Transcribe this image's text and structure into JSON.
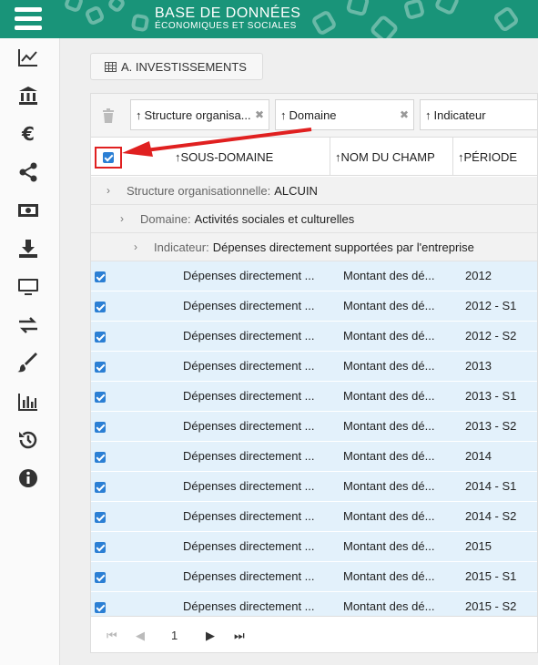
{
  "header": {
    "brand_line1": "BASE DE DONNÉES",
    "brand_line2": "ÉCONOMIQUES ET SOCIALES",
    "colors": {
      "brand": "#199479",
      "selected_row": "#e3f1fb",
      "checkbox": "#2b7fd4",
      "annotation": "#e02020"
    }
  },
  "sidebar": {
    "items": [
      {
        "icon": "line-chart-icon"
      },
      {
        "icon": "bank-icon"
      },
      {
        "icon": "euro-icon"
      },
      {
        "icon": "share-icon"
      },
      {
        "icon": "money-icon"
      },
      {
        "icon": "download-icon"
      },
      {
        "icon": "monitor-icon"
      },
      {
        "icon": "exchange-icon"
      },
      {
        "icon": "brush-icon"
      },
      {
        "icon": "bar-chart-icon"
      },
      {
        "icon": "history-icon"
      },
      {
        "icon": "info-icon"
      }
    ]
  },
  "tab": {
    "label": "A. INVESTISSEMENTS"
  },
  "grouping": {
    "chips": [
      {
        "label": "Structure organisa..."
      },
      {
        "label": "Domaine"
      },
      {
        "label": "Indicateur"
      }
    ]
  },
  "columns": [
    {
      "label": "SOUS-DOMAINE"
    },
    {
      "label": "NOM DU CHAMP"
    },
    {
      "label": "PÉRIODE"
    }
  ],
  "groups": [
    {
      "label": "Structure organisationnelle:",
      "value": "ALCUIN"
    },
    {
      "label": "Domaine:",
      "value": "Activités sociales et culturelles"
    },
    {
      "label": "Indicateur:",
      "value": "Dépenses directement supportées par l'entreprise"
    }
  ],
  "rows": [
    {
      "sous_domaine": "Dépenses directement ...",
      "nom_champ": "Montant des dé...",
      "periode": "2012"
    },
    {
      "sous_domaine": "Dépenses directement ...",
      "nom_champ": "Montant des dé...",
      "periode": "2012 - S1"
    },
    {
      "sous_domaine": "Dépenses directement ...",
      "nom_champ": "Montant des dé...",
      "periode": "2012 - S2"
    },
    {
      "sous_domaine": "Dépenses directement ...",
      "nom_champ": "Montant des dé...",
      "periode": "2013"
    },
    {
      "sous_domaine": "Dépenses directement ...",
      "nom_champ": "Montant des dé...",
      "periode": "2013 - S1"
    },
    {
      "sous_domaine": "Dépenses directement ...",
      "nom_champ": "Montant des dé...",
      "periode": "2013 - S2"
    },
    {
      "sous_domaine": "Dépenses directement ...",
      "nom_champ": "Montant des dé...",
      "periode": "2014"
    },
    {
      "sous_domaine": "Dépenses directement ...",
      "nom_champ": "Montant des dé...",
      "periode": "2014 - S1"
    },
    {
      "sous_domaine": "Dépenses directement ...",
      "nom_champ": "Montant des dé...",
      "periode": "2014 - S2"
    },
    {
      "sous_domaine": "Dépenses directement ...",
      "nom_champ": "Montant des dé...",
      "periode": "2015"
    },
    {
      "sous_domaine": "Dépenses directement ...",
      "nom_champ": "Montant des dé...",
      "periode": "2015 - S1"
    },
    {
      "sous_domaine": "Dépenses directement ...",
      "nom_champ": "Montant des dé...",
      "periode": "2015 - S2"
    }
  ],
  "pager": {
    "page": "1"
  }
}
